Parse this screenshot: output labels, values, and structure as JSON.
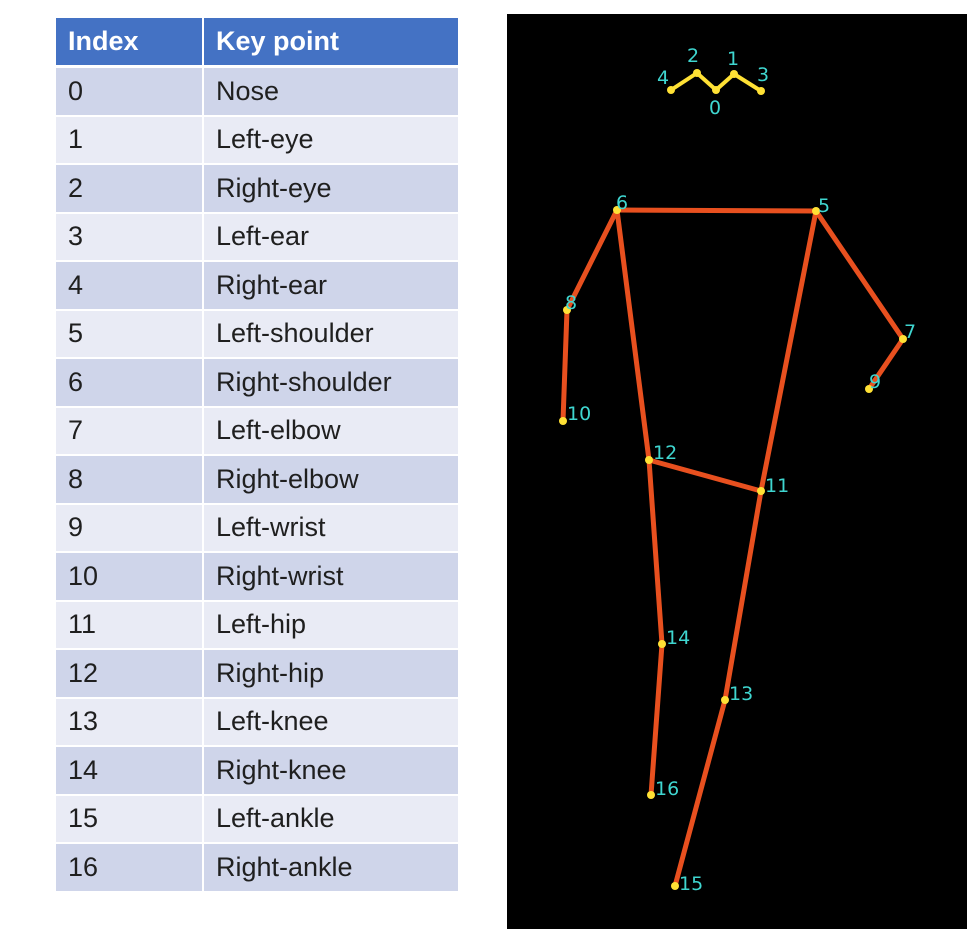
{
  "table": {
    "headers": [
      "Index",
      "Key point"
    ],
    "rows": [
      {
        "index": "0",
        "name": "Nose"
      },
      {
        "index": "1",
        "name": "Left-eye"
      },
      {
        "index": "2",
        "name": "Right-eye"
      },
      {
        "index": "3",
        "name": "Left-ear"
      },
      {
        "index": "4",
        "name": "Right-ear"
      },
      {
        "index": "5",
        "name": "Left-shoulder"
      },
      {
        "index": "6",
        "name": "Right-shoulder"
      },
      {
        "index": "7",
        "name": "Left-elbow"
      },
      {
        "index": "8",
        "name": "Right-elbow"
      },
      {
        "index": "9",
        "name": "Left-wrist"
      },
      {
        "index": "10",
        "name": "Right-wrist"
      },
      {
        "index": "11",
        "name": "Left-hip"
      },
      {
        "index": "12",
        "name": "Right-hip"
      },
      {
        "index": "13",
        "name": "Left-knee"
      },
      {
        "index": "14",
        "name": "Right-knee"
      },
      {
        "index": "15",
        "name": "Left-ankle"
      },
      {
        "index": "16",
        "name": "Right-ankle"
      }
    ]
  },
  "skeleton": {
    "keypoint_labels": [
      "0",
      "1",
      "2",
      "3",
      "4",
      "5",
      "6",
      "7",
      "8",
      "9",
      "10",
      "11",
      "12",
      "13",
      "14",
      "15",
      "16"
    ],
    "face_links": [
      [
        4,
        2
      ],
      [
        2,
        0
      ],
      [
        0,
        1
      ],
      [
        1,
        3
      ]
    ],
    "bones": [
      [
        5,
        6
      ],
      [
        6,
        8
      ],
      [
        8,
        10
      ],
      [
        5,
        7
      ],
      [
        7,
        9
      ],
      [
        6,
        12
      ],
      [
        5,
        11
      ],
      [
        12,
        11
      ],
      [
        12,
        14
      ],
      [
        14,
        16
      ],
      [
        11,
        13
      ],
      [
        13,
        15
      ]
    ],
    "colors": {
      "background": "#000000",
      "bone": "#e8501f",
      "keypoint": "#ffe135",
      "label": "#3fd6d0"
    }
  }
}
